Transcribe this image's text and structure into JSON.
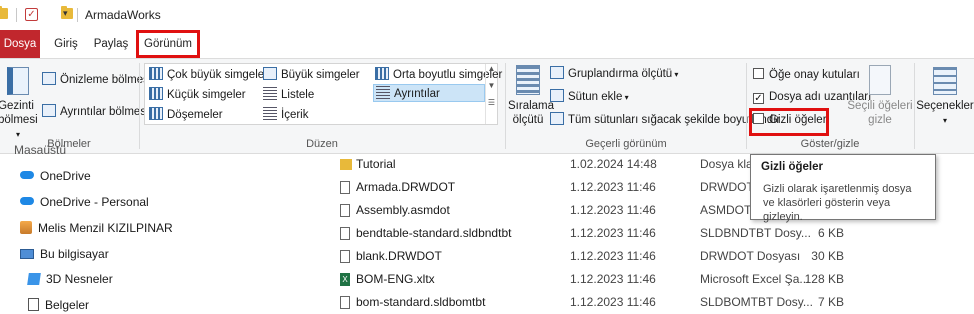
{
  "window": {
    "title": "ArmadaWorks"
  },
  "tabs": [
    "Dosya",
    "Giriş",
    "Paylaş",
    "Görünüm"
  ],
  "ribbon": {
    "panes": {
      "nav_pane_label": "Gezinti bölmesi",
      "preview_pane": "Önizleme bölmesi",
      "details_pane": "Ayrıntılar bölmesi",
      "group": "Bölmeler"
    },
    "layout": {
      "items": [
        "Çok büyük simgeler",
        "Büyük simgeler",
        "Orta boyutlu simgeler",
        "Küçük simgeler",
        "Listele",
        "Ayrıntılar",
        "Döşemeler",
        "İçerik"
      ],
      "selected": "Ayrıntılar",
      "group": "Düzen"
    },
    "current_view": {
      "sort_label": "Sıralama ölçütü",
      "group_by": "Gruplandırma ölçütü",
      "add_column": "Sütun ekle",
      "fit_columns": "Tüm sütunları sığacak şekilde boyutlandır",
      "group": "Geçerli görünüm"
    },
    "show_hide": {
      "item_checkboxes": "Öğe onay kutuları",
      "file_extensions": "Dosya adı uzantıları",
      "hidden_items": "Gizli öğeler",
      "hide_selected": "Seçili öğeleri gizle",
      "group": "Göster/gizle"
    },
    "options_label": "Seçenekler"
  },
  "nav": [
    {
      "label": "Masaüstü"
    },
    {
      "label": "OneDrive"
    },
    {
      "label": "OneDrive - Personal"
    },
    {
      "label": "Melis Menzil KIZILPINAR"
    },
    {
      "label": "Bu bilgisayar"
    },
    {
      "label": "3D Nesneler"
    },
    {
      "label": "Belgeler"
    }
  ],
  "files": [
    {
      "name": "Tutorial",
      "date": "1.02.2024 14:48",
      "type": "Dosya klas",
      "size": ""
    },
    {
      "name": "Armada.DRWDOT",
      "date": "1.12.2023 11:46",
      "type": "DRWDOT D",
      "size": ""
    },
    {
      "name": "Assembly.asmdot",
      "date": "1.12.2023 11:46",
      "type": "ASMDOT D",
      "size": ""
    },
    {
      "name": "bendtable-standard.sldbndtbt",
      "date": "1.12.2023 11:46",
      "type": "SLDBNDTBT Dosy...",
      "size": "6 KB"
    },
    {
      "name": "blank.DRWDOT",
      "date": "1.12.2023 11:46",
      "type": "DRWDOT Dosyası",
      "size": "30 KB"
    },
    {
      "name": "BOM-ENG.xltx",
      "date": "1.12.2023 11:46",
      "type": "Microsoft Excel Şa...",
      "size": "128 KB"
    },
    {
      "name": "bom-standard.sldbomtbt",
      "date": "1.12.2023 11:46",
      "type": "SLDBOMTBT Dosy...",
      "size": "7 KB"
    }
  ],
  "tooltip": {
    "title": "Gizli öğeler",
    "body": "Gizli olarak işaretlenmiş dosya ve klasörleri gösterin veya gizleyin."
  },
  "colors": {
    "file_tab": "#c1272d",
    "highlight": "#e01010",
    "selected_view": "#cce4f7"
  }
}
